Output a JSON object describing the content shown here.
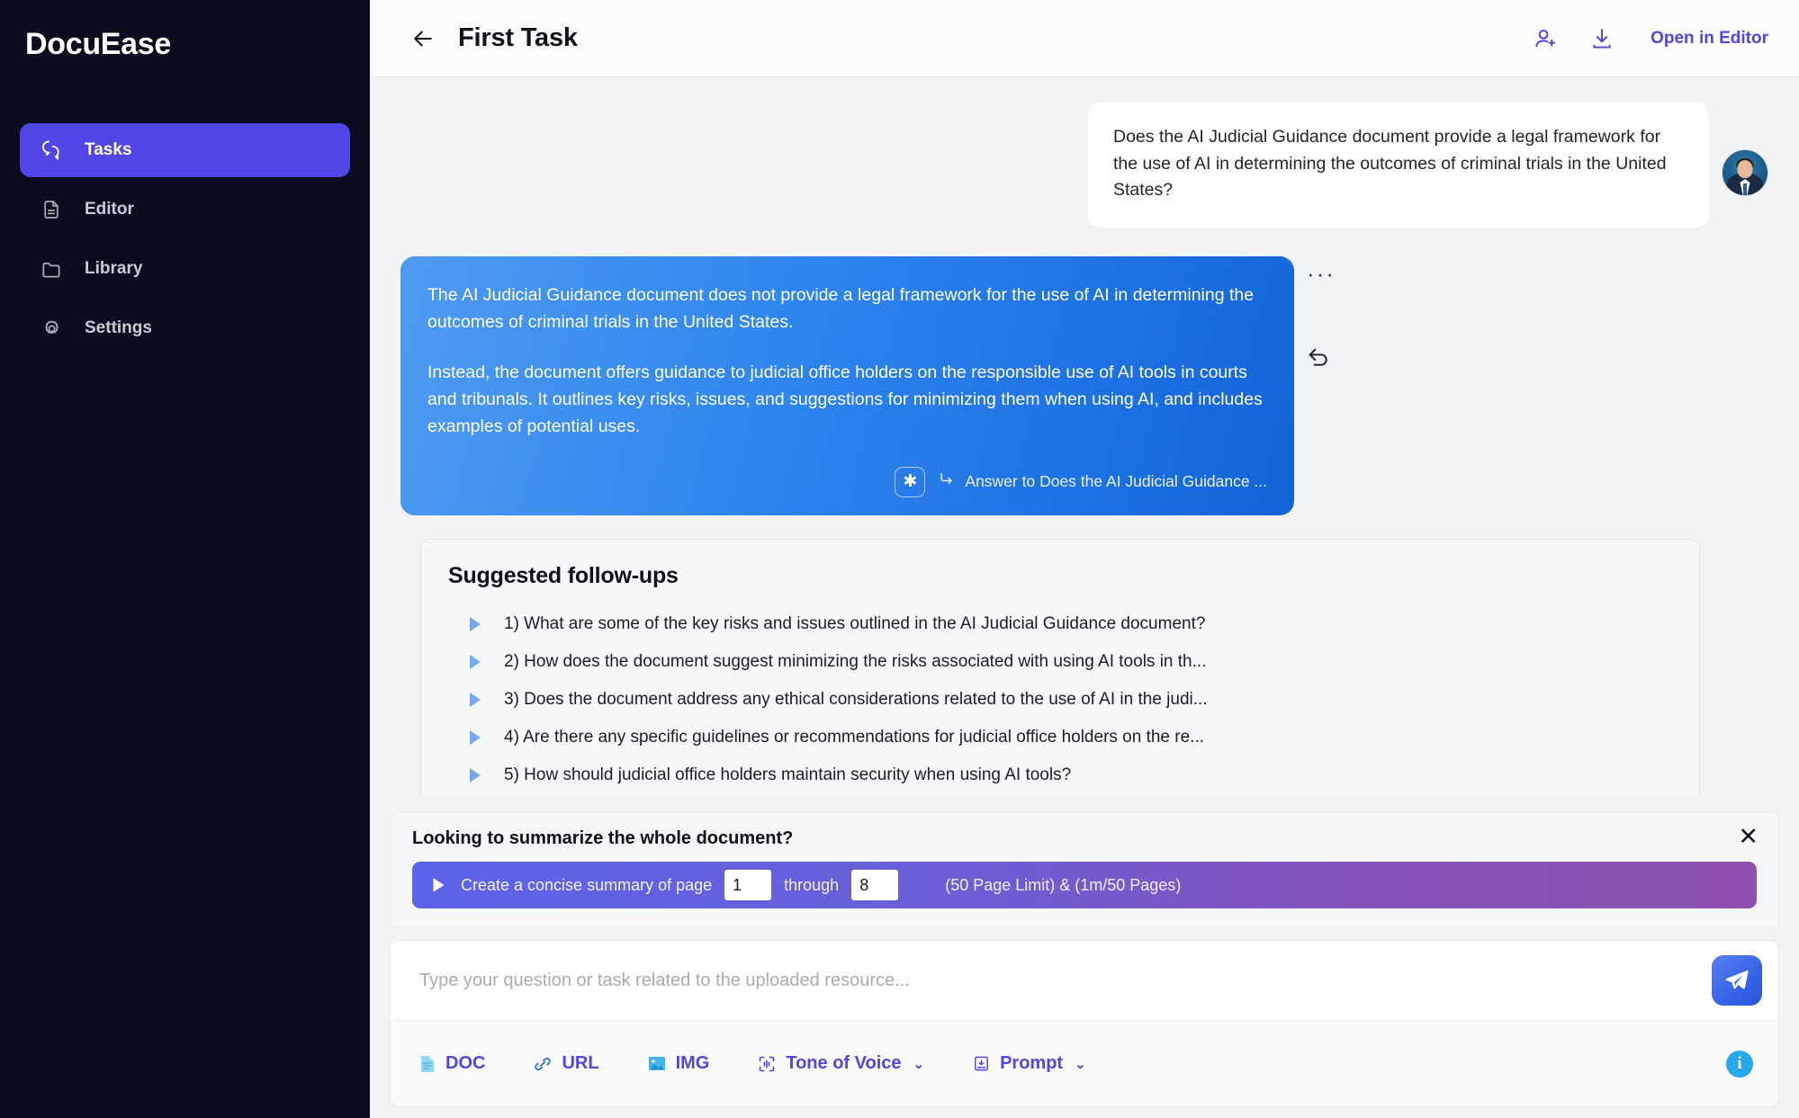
{
  "sidebar": {
    "brand": "DocuEase",
    "items": [
      {
        "label": "Tasks",
        "icon": "chat-bubbles-icon",
        "active": true
      },
      {
        "label": "Editor",
        "icon": "document-icon",
        "active": false
      },
      {
        "label": "Library",
        "icon": "folder-icon",
        "active": false
      },
      {
        "label": "Settings",
        "icon": "gear-icon",
        "active": false
      }
    ]
  },
  "header": {
    "back_icon": "arrow-left-icon",
    "title": "First Task",
    "add_user_icon": "user-plus-icon",
    "download_icon": "download-icon",
    "open_in_editor": "Open in Editor"
  },
  "conversation": {
    "user_message": "Does the AI Judicial Guidance document provide a legal framework for the use of AI in determining the outcomes of criminal trials in the United States?",
    "ai_paragraph_1": "The AI Judicial Guidance document does not provide a legal framework for the use of AI in determining the outcomes of criminal trials in the United States.",
    "ai_paragraph_2": "Instead, the document offers guidance to judicial office holders on the responsible use of AI tools in courts and tribunals. It outlines key risks, issues, and suggestions for minimizing them when using AI, and includes examples of potential uses.",
    "star_badge": "✱",
    "answer_reference": "Answer to Does the AI Judicial Guidance ...",
    "more_options": "···",
    "regenerate_icon": "undo-arrow-icon"
  },
  "followups": {
    "title": "Suggested follow-ups",
    "items": [
      "1) What are some of the key risks and issues outlined in the AI Judicial Guidance document?",
      "2) How does the document suggest minimizing the risks associated with using AI tools in th...",
      "3) Does the document address any ethical considerations related to the use of AI in the judi...",
      "4) Are there any specific guidelines or recommendations for judicial office holders on the re...",
      "5) How should judicial office holders maintain security when using AI tools?"
    ]
  },
  "summary": {
    "title": "Looking to summarize the whole document?",
    "close_icon": "close-icon",
    "action_prefix": "Create a concise summary of page",
    "page_from": "1",
    "through_label": "through",
    "page_to": "8",
    "note": "(50 Page Limit) & (1m/50 Pages)"
  },
  "composer": {
    "placeholder": "Type your question or task related to the uploaded resource...",
    "value": "",
    "send_icon": "send-paper-plane-icon",
    "tools": [
      {
        "label": "DOC",
        "icon": "document-file-icon",
        "caret": ""
      },
      {
        "label": "URL",
        "icon": "link-icon",
        "caret": ""
      },
      {
        "label": "IMG",
        "icon": "image-icon",
        "caret": ""
      },
      {
        "label": "Tone of Voice",
        "icon": "tone-scan-icon",
        "caret": "⌄"
      },
      {
        "label": "Prompt",
        "icon": "prompt-box-icon",
        "caret": "⌄"
      }
    ],
    "info_icon": "info-icon",
    "info_glyph": "i"
  },
  "colors": {
    "sidebar_bg": "#0b0d1f",
    "accent": "#4f46e5",
    "ai_bubble_start": "#4f9bf0",
    "ai_bubble_end": "#1263d8",
    "summary_bar_start": "#5b63e8",
    "summary_bar_end": "#8e4fae",
    "info_blue": "#29a8ea"
  }
}
